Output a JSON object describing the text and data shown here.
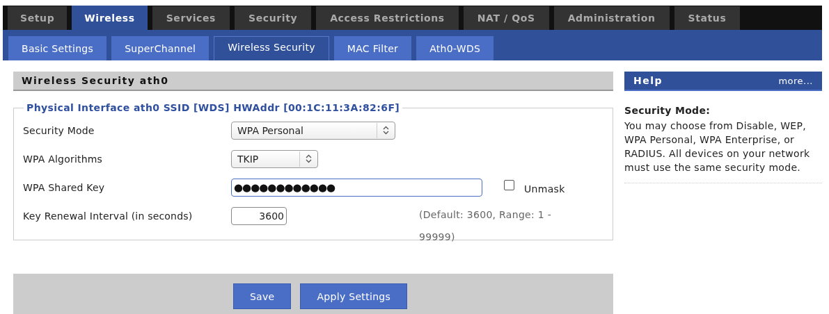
{
  "main_tabs": [
    {
      "label": "Setup",
      "selected": false
    },
    {
      "label": "Wireless",
      "selected": true
    },
    {
      "label": "Services",
      "selected": false
    },
    {
      "label": "Security",
      "selected": false
    },
    {
      "label": "Access Restrictions",
      "selected": false
    },
    {
      "label": "NAT / QoS",
      "selected": false
    },
    {
      "label": "Administration",
      "selected": false
    },
    {
      "label": "Status",
      "selected": false
    }
  ],
  "sub_tabs": [
    {
      "label": "Basic Settings",
      "selected": false
    },
    {
      "label": "SuperChannel",
      "selected": false
    },
    {
      "label": "Wireless Security",
      "selected": true
    },
    {
      "label": "MAC Filter",
      "selected": false
    },
    {
      "label": "Ath0-WDS",
      "selected": false
    }
  ],
  "section": {
    "title": "Wireless Security ath0",
    "legend": "Physical Interface ath0 SSID [WDS] HWAddr [00:1C:11:3A:82:6F]",
    "rows": [
      {
        "kind": "select",
        "label": "Security Mode",
        "value": "WPA Personal"
      },
      {
        "kind": "select",
        "label": "WPA Algorithms",
        "value": "TKIP"
      },
      {
        "kind": "password",
        "label": "WPA Shared Key",
        "value": "●●●●●●●●●●●●",
        "checkbox": {
          "label": "Unmask",
          "checked": false
        }
      },
      {
        "kind": "number",
        "label": "Key Renewal Interval (in seconds)",
        "value": "3600",
        "hint": "(Default: 3600, Range: 1 - 99999)"
      }
    ]
  },
  "buttons": [
    "Save",
    "Apply Settings"
  ],
  "help": {
    "title": "Help",
    "more": "more...",
    "heading": "Security Mode:",
    "text": "You may choose from Disable, WEP, WPA Personal, WPA Enterprise, or RADIUS. All devices on your network must use the same security mode."
  }
}
